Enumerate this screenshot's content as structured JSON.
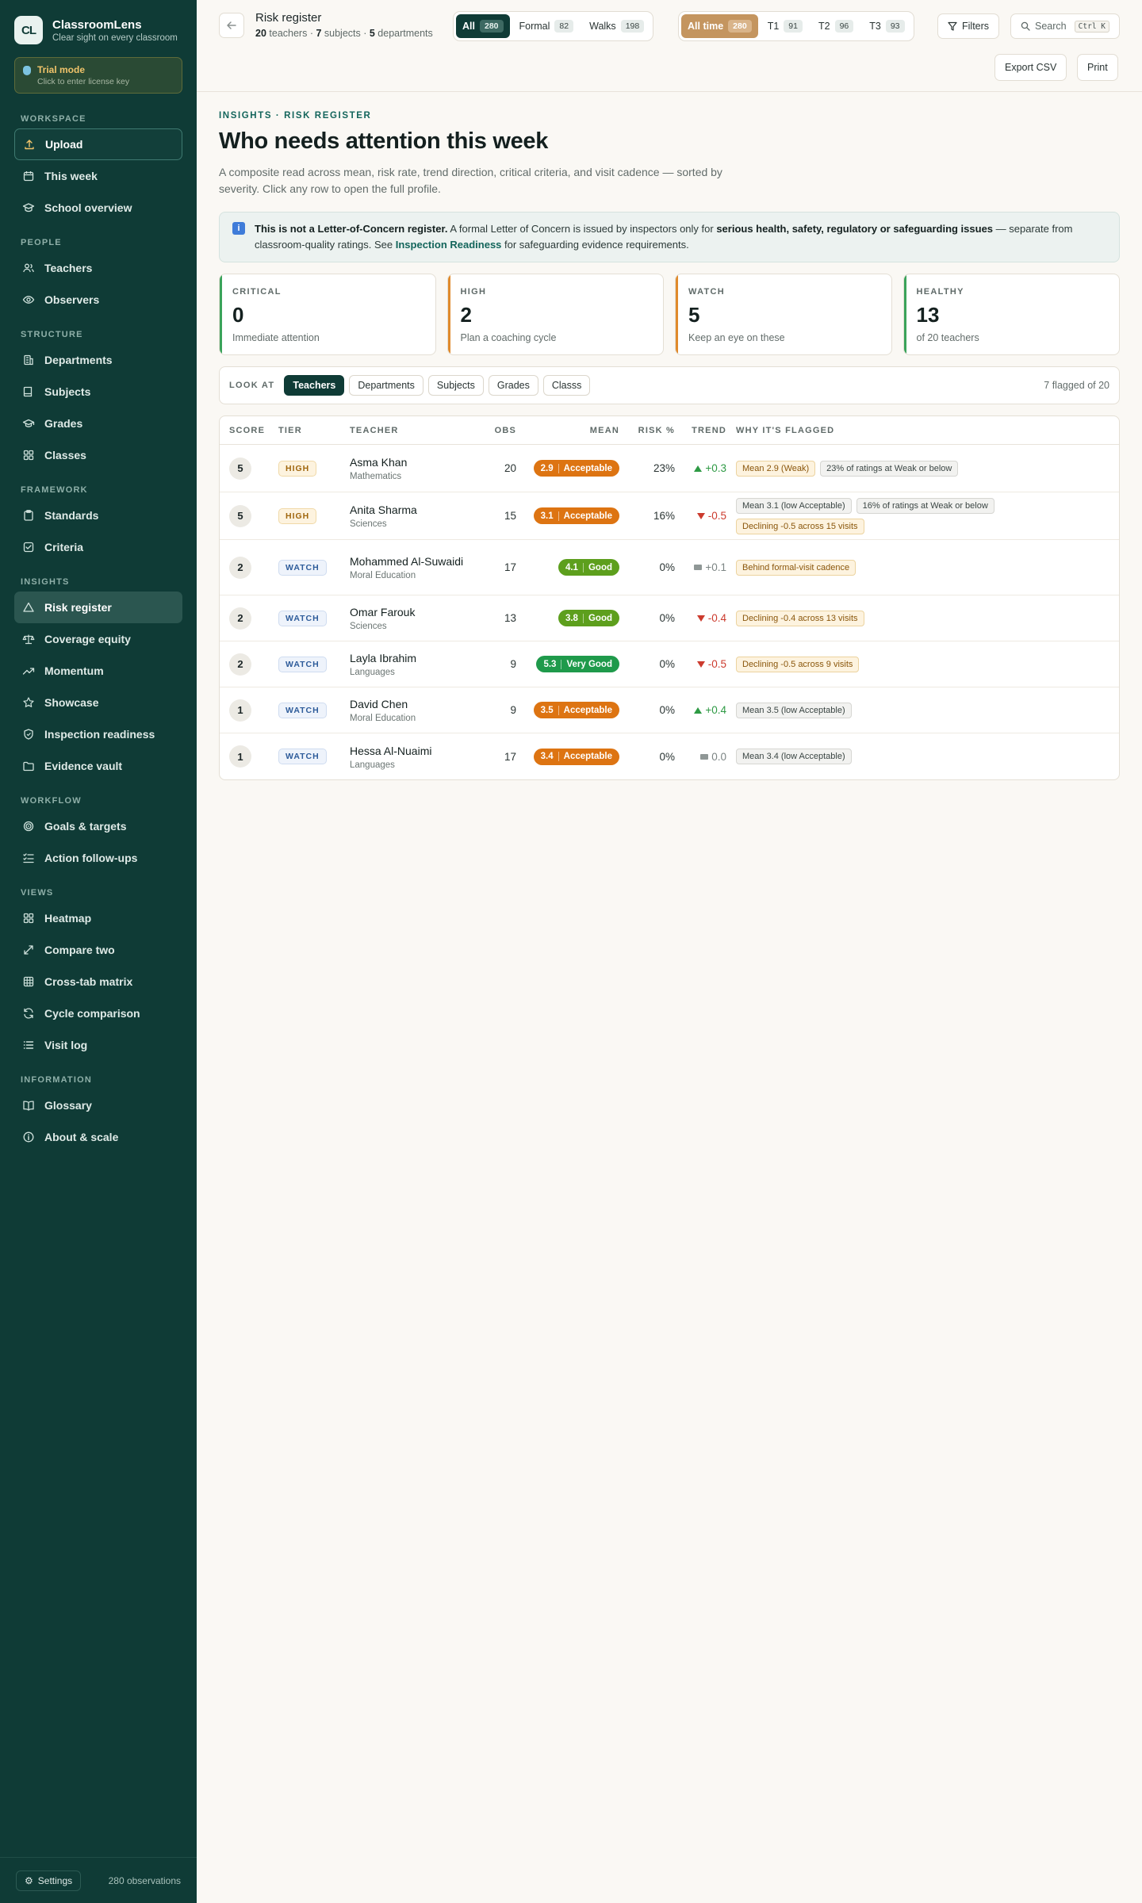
{
  "brand": {
    "logo": "CL",
    "name": "ClassroomLens",
    "tagline": "Clear sight on every classroom"
  },
  "trial": {
    "title": "Trial mode",
    "subtitle": "Click to enter license key"
  },
  "sidebar": {
    "sections": [
      {
        "label": "WORKSPACE",
        "items": [
          {
            "label": "Upload",
            "icon": "upload-icon",
            "state": "outlined"
          },
          {
            "label": "This week",
            "icon": "calendar-icon"
          },
          {
            "label": "School overview",
            "icon": "school-icon"
          }
        ]
      },
      {
        "label": "PEOPLE",
        "items": [
          {
            "label": "Teachers",
            "icon": "users-icon"
          },
          {
            "label": "Observers",
            "icon": "eye-icon"
          }
        ]
      },
      {
        "label": "STRUCTURE",
        "items": [
          {
            "label": "Departments",
            "icon": "building-icon"
          },
          {
            "label": "Subjects",
            "icon": "book-icon"
          },
          {
            "label": "Grades",
            "icon": "graduation-cap-icon"
          },
          {
            "label": "Classes",
            "icon": "grid-icon"
          }
        ]
      },
      {
        "label": "FRAMEWORK",
        "items": [
          {
            "label": "Standards",
            "icon": "clipboard-icon"
          },
          {
            "label": "Criteria",
            "icon": "checklist-icon"
          }
        ]
      },
      {
        "label": "INSIGHTS",
        "items": [
          {
            "label": "Risk register",
            "icon": "warning-triangle-icon",
            "state": "active"
          },
          {
            "label": "Coverage equity",
            "icon": "scale-icon"
          },
          {
            "label": "Momentum",
            "icon": "trending-up-icon"
          },
          {
            "label": "Showcase",
            "icon": "star-icon"
          },
          {
            "label": "Inspection readiness",
            "icon": "shield-icon"
          },
          {
            "label": "Evidence vault",
            "icon": "folder-icon"
          }
        ]
      },
      {
        "label": "WORKFLOW",
        "items": [
          {
            "label": "Goals & targets",
            "icon": "target-icon"
          },
          {
            "label": "Action follow-ups",
            "icon": "list-check-icon"
          }
        ]
      },
      {
        "label": "VIEWS",
        "items": [
          {
            "label": "Heatmap",
            "icon": "heatmap-icon"
          },
          {
            "label": "Compare two",
            "icon": "compare-icon"
          },
          {
            "label": "Cross-tab matrix",
            "icon": "table-icon"
          },
          {
            "label": "Cycle comparison",
            "icon": "cycle-icon"
          },
          {
            "label": "Visit log",
            "icon": "list-icon"
          }
        ]
      },
      {
        "label": "INFORMATION",
        "items": [
          {
            "label": "Glossary",
            "icon": "open-book-icon"
          },
          {
            "label": "About & scale",
            "icon": "info-circle-icon"
          }
        ]
      }
    ],
    "footer": {
      "settings_label": "Settings",
      "observations": "280 observations"
    }
  },
  "topbar": {
    "title": "Risk register",
    "stats": {
      "teachers_n": "20",
      "teachers_l": "teachers",
      "subjects_n": "7",
      "subjects_l": "subjects",
      "departments_n": "5",
      "departments_l": "departments"
    },
    "type_filter": [
      {
        "label": "All",
        "count": "280",
        "active": true
      },
      {
        "label": "Formal",
        "count": "82"
      },
      {
        "label": "Walks",
        "count": "198"
      }
    ],
    "term_filter": [
      {
        "label": "All time",
        "count": "280",
        "active": true
      },
      {
        "label": "T1",
        "count": "91"
      },
      {
        "label": "T2",
        "count": "96"
      },
      {
        "label": "T3",
        "count": "93"
      }
    ],
    "filters_label": "Filters",
    "search_label": "Search",
    "search_kbd": "Ctrl K",
    "export_label": "Export CSV",
    "print_label": "Print"
  },
  "page": {
    "eyebrow": "INSIGHTS · RISK REGISTER",
    "title": "Who needs attention this week",
    "lede": "A composite read across mean, risk rate, trend direction, critical criteria, and visit cadence — sorted by severity. Click any row to open the full profile.",
    "notice": {
      "lead": "This is not a Letter-of-Concern register.",
      "t1": " A formal Letter of Concern is issued by inspectors only for ",
      "bold": "serious health, safety, regulatory or safeguarding issues",
      "t2": " — separate from classroom-quality ratings. See ",
      "link": "Inspection Readiness",
      "t3": " for safeguarding evidence requirements."
    }
  },
  "stats": [
    {
      "label": "CRITICAL",
      "value": "0",
      "sub": "Immediate attention",
      "color": "#3aa35a"
    },
    {
      "label": "HIGH",
      "value": "2",
      "sub": "Plan a coaching cycle",
      "color": "#e08a2c"
    },
    {
      "label": "WATCH",
      "value": "5",
      "sub": "Keep an eye on these",
      "color": "#e08a2c"
    },
    {
      "label": "HEALTHY",
      "value": "13",
      "sub": "of 20 teachers",
      "color": "#3aa35a"
    }
  ],
  "lookat": {
    "label": "LOOK AT",
    "options": [
      {
        "label": "Teachers",
        "active": true
      },
      {
        "label": "Departments"
      },
      {
        "label": "Subjects"
      },
      {
        "label": "Grades"
      },
      {
        "label": "Classs"
      }
    ],
    "count_label": "7 flagged of 20"
  },
  "table": {
    "headers": {
      "score": "SCORE",
      "tier": "TIER",
      "teacher": "TEACHER",
      "obs": "OBS",
      "mean": "MEAN",
      "risk": "RISK %",
      "trend": "TREND",
      "why": "WHY IT'S FLAGGED"
    },
    "rows": [
      {
        "score": "5",
        "tier": "HIGH",
        "tier_kind": "high",
        "name": "Asma Khan",
        "dept": "Mathematics",
        "obs": "20",
        "mean": "2.9",
        "mean_label": "Acceptable",
        "mean_color": "#dd7412",
        "risk": "23%",
        "trend": "+0.3",
        "trend_dir": "up",
        "flags": [
          {
            "text": "Mean 2.9 (Weak)",
            "kind": "amber"
          },
          {
            "text": "23% of ratings at Weak or below",
            "kind": "gray"
          }
        ]
      },
      {
        "score": "5",
        "tier": "HIGH",
        "tier_kind": "high",
        "name": "Anita Sharma",
        "dept": "Sciences",
        "obs": "15",
        "mean": "3.1",
        "mean_label": "Acceptable",
        "mean_color": "#dd7412",
        "risk": "16%",
        "trend": "-0.5",
        "trend_dir": "down",
        "flags": [
          {
            "text": "Mean 3.1 (low Acceptable)",
            "kind": "gray"
          },
          {
            "text": "16% of ratings at Weak or below",
            "kind": "gray"
          },
          {
            "text": "Declining -0.5 across 15 visits",
            "kind": "amber"
          }
        ]
      },
      {
        "score": "2",
        "tier": "WATCH",
        "tier_kind": "watch",
        "name": "Mohammed Al-Suwaidi",
        "dept": "Moral Education",
        "obs": "17",
        "mean": "4.1",
        "mean_label": "Good",
        "mean_color": "#5d9f1d",
        "risk": "0%",
        "trend": "+0.1",
        "trend_dir": "flat",
        "flags": [
          {
            "text": "Behind formal-visit cadence",
            "kind": "amber"
          }
        ]
      },
      {
        "score": "2",
        "tier": "WATCH",
        "tier_kind": "watch",
        "name": "Omar Farouk",
        "dept": "Sciences",
        "obs": "13",
        "mean": "3.8",
        "mean_label": "Good",
        "mean_color": "#5d9f1d",
        "risk": "0%",
        "trend": "-0.4",
        "trend_dir": "down",
        "flags": [
          {
            "text": "Declining -0.4 across 13 visits",
            "kind": "amber"
          }
        ]
      },
      {
        "score": "2",
        "tier": "WATCH",
        "tier_kind": "watch",
        "name": "Layla Ibrahim",
        "dept": "Languages",
        "obs": "9",
        "mean": "5.3",
        "mean_label": "Very Good",
        "mean_color": "#1f9a4b",
        "risk": "0%",
        "trend": "-0.5",
        "trend_dir": "down",
        "flags": [
          {
            "text": "Declining -0.5 across 9 visits",
            "kind": "amber"
          }
        ]
      },
      {
        "score": "1",
        "tier": "WATCH",
        "tier_kind": "watch",
        "name": "David Chen",
        "dept": "Moral Education",
        "obs": "9",
        "mean": "3.5",
        "mean_label": "Acceptable",
        "mean_color": "#dd7412",
        "risk": "0%",
        "trend": "+0.4",
        "trend_dir": "up",
        "flags": [
          {
            "text": "Mean 3.5 (low Acceptable)",
            "kind": "gray"
          }
        ]
      },
      {
        "score": "1",
        "tier": "WATCH",
        "tier_kind": "watch",
        "name": "Hessa Al-Nuaimi",
        "dept": "Languages",
        "obs": "17",
        "mean": "3.4",
        "mean_label": "Acceptable",
        "mean_color": "#dd7412",
        "risk": "0%",
        "trend": "0.0",
        "trend_dir": "flat",
        "flags": [
          {
            "text": "Mean 3.4 (low Acceptable)",
            "kind": "gray"
          }
        ]
      }
    ]
  }
}
